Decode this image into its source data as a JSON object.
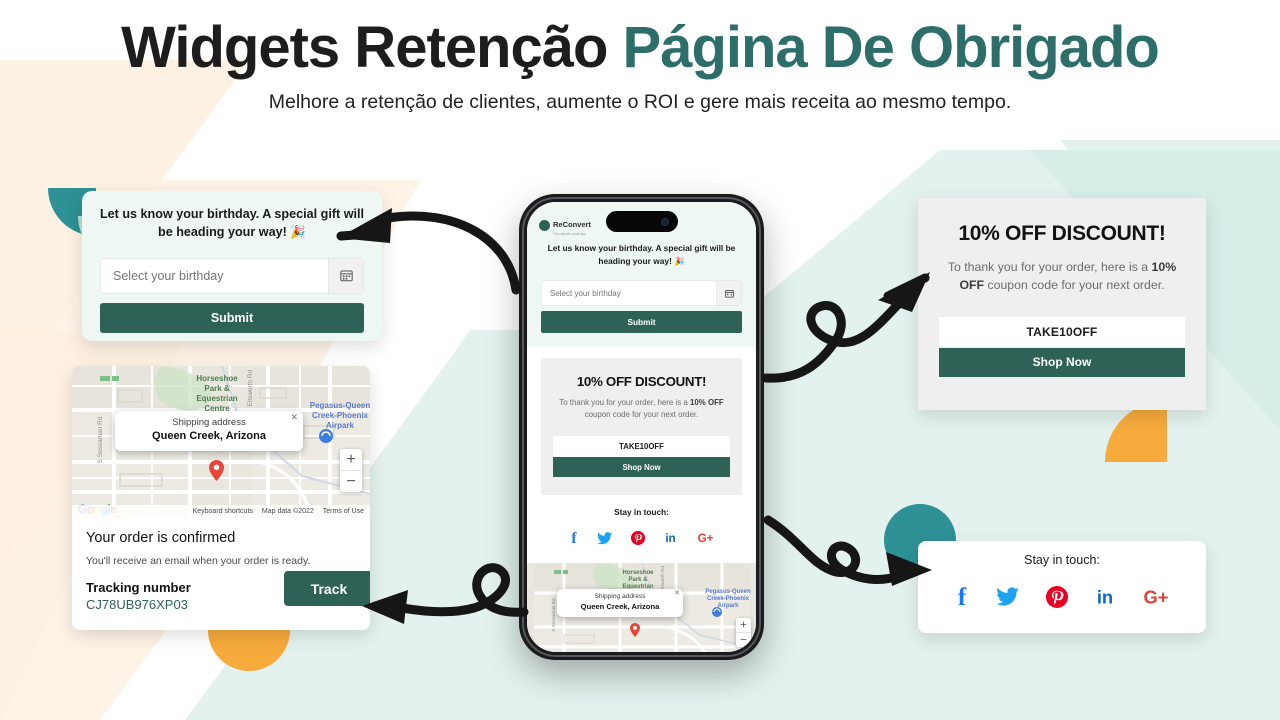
{
  "header": {
    "title_plain": "Widgets Retenção ",
    "title_accent": "Página De Obrigado",
    "subtitle": "Melhore a retenção de clientes, aumente o ROI e gere mais receita ao mesmo tempo.",
    "accent_color": "#2d6e6a"
  },
  "brand": {
    "name": "ReConvert",
    "tagline": "The ultimate upsell app",
    "primary_color": "#2f6257"
  },
  "birthday_widget": {
    "message": "Let us know your birthday. A special gift will be heading your way! 🎉",
    "input_placeholder": "Select your birthday",
    "input_value": "",
    "calendar_icon": "calendar-icon",
    "submit_label": "Submit"
  },
  "discount_widget": {
    "title": "10% OFF DISCOUNT!",
    "subtitle_pre": "To thank you for your order, here is a ",
    "subtitle_bold": "10% OFF",
    "subtitle_post": " coupon code for your next order.",
    "coupon_code": "TAKE10OFF",
    "shop_label": "Shop Now"
  },
  "social_widget": {
    "title": "Stay in touch:",
    "icons": [
      {
        "name": "facebook-icon",
        "glyph": "f",
        "color": "#1877F2"
      },
      {
        "name": "twitter-icon",
        "glyph": "t",
        "color": "#1DA1F2"
      },
      {
        "name": "pinterest-icon",
        "glyph": "p",
        "color": "#E60023"
      },
      {
        "name": "linkedin-icon",
        "glyph": "in",
        "color": "#0A66C2"
      },
      {
        "name": "googleplus-icon",
        "glyph": "G+",
        "color": "#DB4437"
      }
    ]
  },
  "order_widget": {
    "map": {
      "popup_label": "Shipping address",
      "popup_value": "Queen Creek, Arizona",
      "close_icon": "close-icon",
      "zoom_in": "+",
      "zoom_out": "−",
      "logo": "Google",
      "attrib_keyboard": "Keyboard shortcuts",
      "attrib_data": "Map data ©2022",
      "attrib_terms": "Terms of Use",
      "labels": [
        "Horseshoe",
        "Park &",
        "Equestrian",
        "Centre",
        "Pegasus-Queen",
        "Creek-Phoenix",
        "Airpark",
        "S Sossaman Rd",
        "Ellsworth Rd"
      ]
    },
    "confirm_title": "Your order is confirmed",
    "confirm_sub": "You'll receive an email when your order is ready.",
    "tracking_label": "Tracking number",
    "tracking_number": "CJ78UB976XP03",
    "track_label": "Track"
  },
  "phone": {
    "device": "iphone-mockup"
  },
  "decor": {
    "teal_dark": "#2d9196",
    "teal_light": "#b8e0d6",
    "mint": "#e1f1ee",
    "cream": "#fdf0e0",
    "orange": "#f6ab3c",
    "orange_light": "#fcdfae"
  }
}
